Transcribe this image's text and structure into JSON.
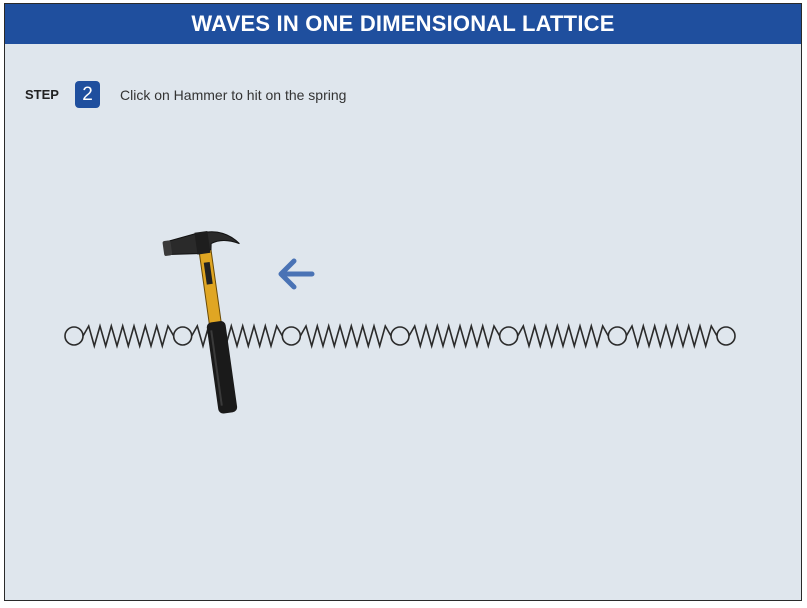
{
  "header": {
    "title": "WAVES IN ONE DIMENSIONAL LATTICE"
  },
  "step": {
    "label": "STEP",
    "number": "2",
    "instruction": "Click on Hammer to hit on the spring"
  },
  "lattice": {
    "mass_count": 7
  },
  "colors": {
    "header_bg": "#1f4f9e",
    "arrow": "#4a73b5",
    "canvas_bg": "#dfe6ed",
    "hammer_handle": "#e0a623",
    "hammer_grip": "#1a1a1a"
  },
  "icons": {
    "arrow": "arrow-left-icon",
    "hammer": "hammer-icon"
  }
}
